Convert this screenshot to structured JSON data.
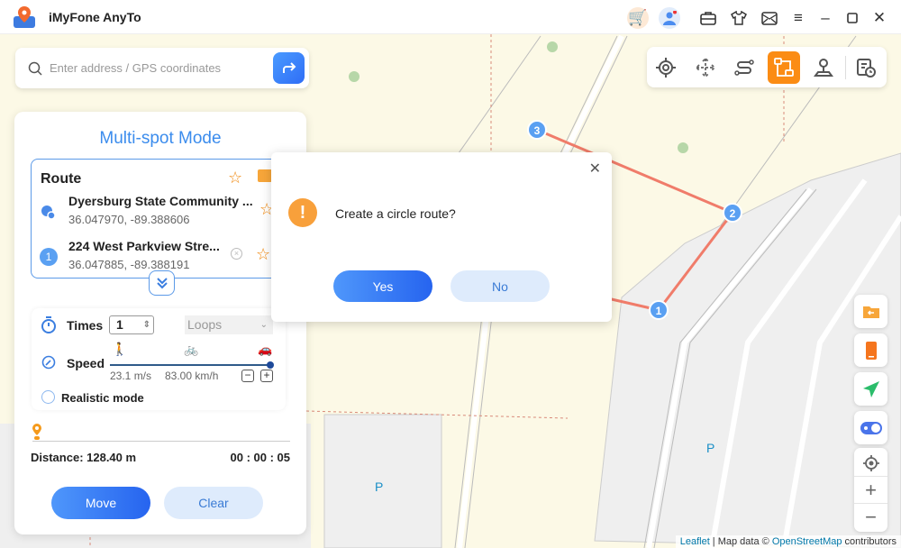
{
  "app": {
    "title": "iMyFone AnyTo"
  },
  "titlebar_icons": [
    "cart-icon",
    "user-icon",
    "briefcase-icon",
    "tshirt-icon",
    "mail-icon",
    "menu-icon",
    "minimize-icon",
    "maximize-icon",
    "close-icon"
  ],
  "search": {
    "placeholder": "Enter address / GPS coordinates"
  },
  "toolbar": {
    "tools": [
      "teleport-mode",
      "two-spot-mode",
      "multi-spot-mode",
      "jump-mode",
      "joystick-mode",
      "history"
    ],
    "active": "jump-mode"
  },
  "panel": {
    "title": "Multi-spot Mode",
    "route_label": "Route",
    "points": [
      {
        "name": "Dyersburg State Community ...",
        "coords": "36.047970, -89.388606"
      },
      {
        "index": "1",
        "name": "224 West Parkview Stre...",
        "coords": "36.047885, -89.388191"
      }
    ],
    "times_label": "Times",
    "times_value": "1",
    "loops_value": "Loops",
    "speed_label": "Speed",
    "speed_ms": "23.1 m/s",
    "speed_kmh": "83.00 km/h",
    "speed_level": 1.0,
    "realistic_label": "Realistic mode",
    "progress": 0,
    "distance": "Distance: 128.40 m",
    "duration": "00 : 00 : 05",
    "move_label": "Move",
    "clear_label": "Clear"
  },
  "dialog": {
    "message": "Create a circle route?",
    "yes_label": "Yes",
    "no_label": "No"
  },
  "map": {
    "markers": [
      "1",
      "2",
      "3"
    ],
    "parking": "P",
    "route_color": "#f07c6a",
    "attribution": {
      "leaflet": "Leaflet",
      "sep": " | Map data © ",
      "osm": "OpenStreetMap",
      "contrib": " contributors"
    }
  },
  "colors": {
    "accent": "#3b8ced",
    "orange": "#fb8c14"
  }
}
